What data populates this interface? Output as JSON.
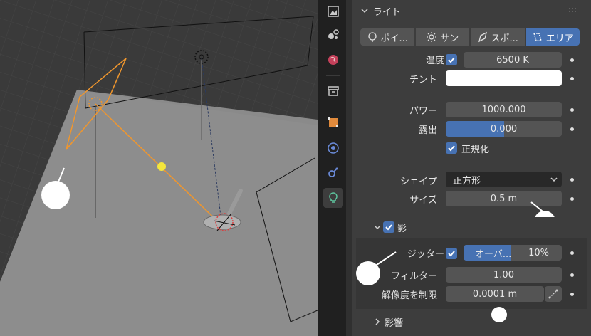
{
  "panel": {
    "light_header": "ライト",
    "light_types": [
      {
        "label": "ポイ...",
        "icon": "point-light-icon",
        "active": false
      },
      {
        "label": "サン",
        "icon": "sun-light-icon",
        "active": false
      },
      {
        "label": "スポ...",
        "icon": "spot-light-icon",
        "active": false
      },
      {
        "label": "エリア",
        "icon": "area-light-icon",
        "active": true
      }
    ],
    "temperature_label": "温度",
    "temperature_value": "6500 K",
    "tint_label": "チント",
    "power_label": "パワー",
    "power_value": "1000.000",
    "exposure_label": "露出",
    "exposure_value": "0.000",
    "normalize_label": "正規化",
    "shape_label": "シェイプ",
    "shape_value": "正方形",
    "size_label": "サイズ",
    "size_value": "0.5 m",
    "shadow_header": "影",
    "jitter_label": "ジッター",
    "jitter_overlay_text": "オーバ...",
    "jitter_percent": "10%",
    "jitter_fraction": 0.1,
    "filter_label": "フィルター",
    "filter_value": "1.00",
    "resolution_label": "解像度を制限",
    "resolution_value": "0.0001 m",
    "influence_header": "影響"
  },
  "colors": {
    "accent": "#4772b3",
    "panel_bg": "#3d3d3d",
    "field_bg": "#545454",
    "tint": "#ffffff",
    "selection_orange": "#f0962d",
    "light_yellow": "#f5e63c"
  },
  "tabs": [
    {
      "icon": "render-icon"
    },
    {
      "icon": "particles-icon"
    },
    {
      "icon": "world-icon"
    },
    {
      "icon": "collection-icon"
    },
    {
      "icon": "object-icon"
    },
    {
      "icon": "physics-icon"
    },
    {
      "icon": "constraints-icon"
    },
    {
      "icon": "light-data-icon",
      "active": true
    }
  ]
}
